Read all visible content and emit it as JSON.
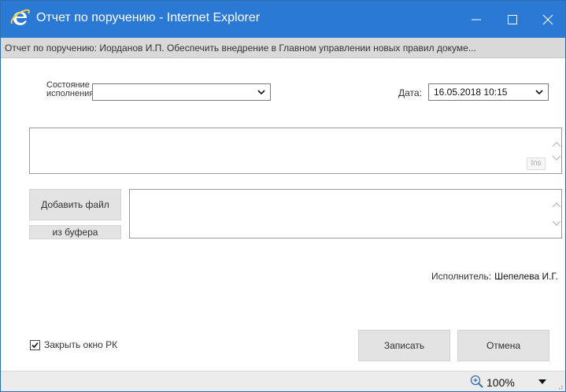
{
  "window": {
    "title": "Отчет по поручению - Internet Explorer",
    "subtitle": "Отчет по поручению: Иорданов И.П. Обеспечить внедрение в Главном управлении новых правил докуме..."
  },
  "form": {
    "state_label": "Состояние исполнения:",
    "state_value": "",
    "date_label": "Дата:",
    "date_value": "16.05.2018 10:15",
    "report_text": "",
    "ins_label": "Ins",
    "add_file_label": "Добавить файл",
    "from_buffer_label": "из буфера",
    "executor_label": "Исполнитель:",
    "executor_name": "Шепелева И.Г.",
    "close_checkbox_label": "Закрыть окно РК",
    "close_checkbox_checked": true,
    "save_label": "Записать",
    "cancel_label": "Отмена"
  },
  "statusbar": {
    "zoom": "100%"
  },
  "colors": {
    "titlebar": "#2a79d4",
    "subtitle_bg": "#d9d9d9",
    "button_bg": "#e3e3e3"
  },
  "icons": [
    "ie-logo-icon",
    "minimize-icon",
    "maximize-icon",
    "close-icon",
    "chevron-down-icon",
    "scroll-up-icon",
    "scroll-down-icon",
    "zoom-in-icon",
    "dropdown-arrow-icon",
    "resize-grip-icon",
    "checkmark-icon"
  ]
}
